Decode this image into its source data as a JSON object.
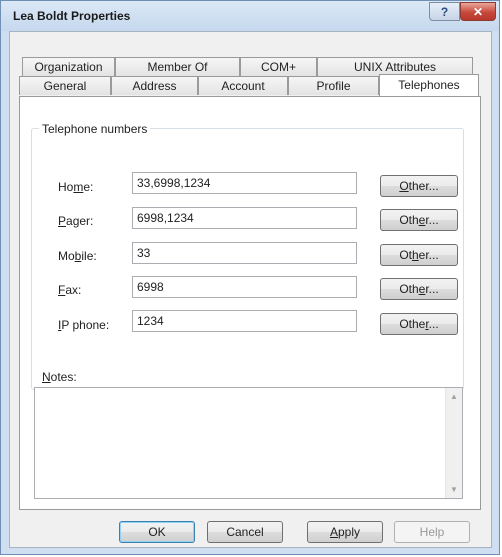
{
  "window": {
    "title": "Lea Boldt Properties",
    "help_glyph": "?",
    "close_glyph": "✕"
  },
  "tabs_row1": [
    "Organization",
    "Member Of",
    "COM+",
    "UNIX Attributes"
  ],
  "tabs_row2": [
    "General",
    "Address",
    "Account",
    "Profile",
    "Telephones"
  ],
  "active_tab": "Telephones",
  "group_title": "Telephone numbers",
  "phones": [
    {
      "label_pre": "Ho",
      "label_u": "m",
      "label_post": "e:",
      "value": "33,6998,1234"
    },
    {
      "label_pre": "",
      "label_u": "P",
      "label_post": "ager:",
      "value": "6998,1234"
    },
    {
      "label_pre": "Mo",
      "label_u": "b",
      "label_post": "ile:",
      "value": "33"
    },
    {
      "label_pre": "",
      "label_u": "F",
      "label_post": "ax:",
      "value": "6998"
    },
    {
      "label_pre": "",
      "label_u": "I",
      "label_post": "P phone:",
      "value": "1234"
    }
  ],
  "other_buttons": [
    {
      "pre": "",
      "u": "O",
      "post": "ther..."
    },
    {
      "pre": "Oth",
      "u": "e",
      "post": "r..."
    },
    {
      "pre": "Ot",
      "u": "h",
      "post": "er..."
    },
    {
      "pre": "Oth",
      "u": "e",
      "post": "r..."
    },
    {
      "pre": "Othe",
      "u": "r",
      "post": "..."
    }
  ],
  "notes_label": {
    "u": "N",
    "post": "otes:"
  },
  "notes_value": "",
  "buttons": {
    "ok": "OK",
    "cancel": "Cancel",
    "apply_u": "A",
    "apply_post": "pply",
    "help": "Help"
  }
}
